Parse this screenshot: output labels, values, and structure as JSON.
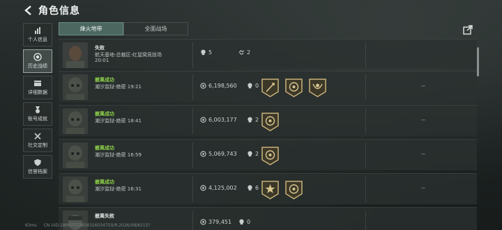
{
  "header": {
    "title": "角色信息",
    "back_icon": "back-arrow-icon"
  },
  "sidebar": {
    "items": [
      {
        "label": "个人信息",
        "icon": "bar-chart-icon",
        "active": false
      },
      {
        "label": "历史战绩",
        "icon": "history-icon",
        "active": true
      },
      {
        "label": "详细数据",
        "icon": "folder-icon",
        "active": false
      },
      {
        "label": "账号成就",
        "icon": "medal-icon",
        "active": false
      },
      {
        "label": "社交定制",
        "icon": "crossed-tools-icon",
        "active": false
      },
      {
        "label": "信誉档案",
        "icon": "shield-icon",
        "active": false
      }
    ]
  },
  "tabs": [
    {
      "label": "烽火地带",
      "active": true
    },
    {
      "label": "全面战场",
      "active": false
    }
  ],
  "share_icon": "share-icon",
  "matches": [
    {
      "result": "失败",
      "result_type": "fail",
      "map": "航天基地-总裁区-红鼠窝竞技场",
      "time": "20:01",
      "value": "5",
      "stat2_icon": "handshake-icon",
      "stat2": "2",
      "badges": [],
      "extra": ""
    },
    {
      "result": "撤离成功",
      "result_type": "success",
      "map": "潮汐监狱-绝密 19:21",
      "time": "",
      "value": "6,198,560",
      "stat2_icon": "skull-icon",
      "stat2": "0",
      "badges": [
        "sword-badge-icon",
        "target-badge-icon",
        "wreath-badge-icon"
      ],
      "extra": "--"
    },
    {
      "result": "撤离成功",
      "result_type": "success",
      "map": "潮汐监狱-绝密 18:41",
      "time": "",
      "value": "6,003,177",
      "stat2_icon": "skull-icon",
      "stat2": "2",
      "badges": [
        "target-badge-icon"
      ],
      "extra": "--"
    },
    {
      "result": "撤离成功",
      "result_type": "success",
      "map": "潮汐监狱-绝密 16:59",
      "time": "",
      "value": "5,069,743",
      "stat2_icon": "skull-icon",
      "stat2": "2",
      "badges": [
        "target-badge-icon"
      ],
      "extra": "--"
    },
    {
      "result": "撤离成功",
      "result_type": "success",
      "map": "潮汐监狱-绝密 16:31",
      "time": "",
      "value": "4,125,002",
      "stat2_icon": "skull-icon",
      "stat2": "6",
      "badges": [
        "star-badge-icon",
        "target-badge-icon"
      ],
      "extra": "--"
    },
    {
      "result": "撤离失败",
      "result_type": "fail",
      "map": "",
      "time": "",
      "value": "379,451",
      "stat2_icon": "skull-icon",
      "stat2": "0",
      "badges": [],
      "extra": ""
    }
  ],
  "footer": {
    "ping": "63ms",
    "uid": "CN UID:18997372854316034750/R.2026/08/8215?"
  },
  "colors": {
    "accent_tab": "#4b6760",
    "success_green": "#8fd14a",
    "badge_gold": "#c9b27a"
  }
}
